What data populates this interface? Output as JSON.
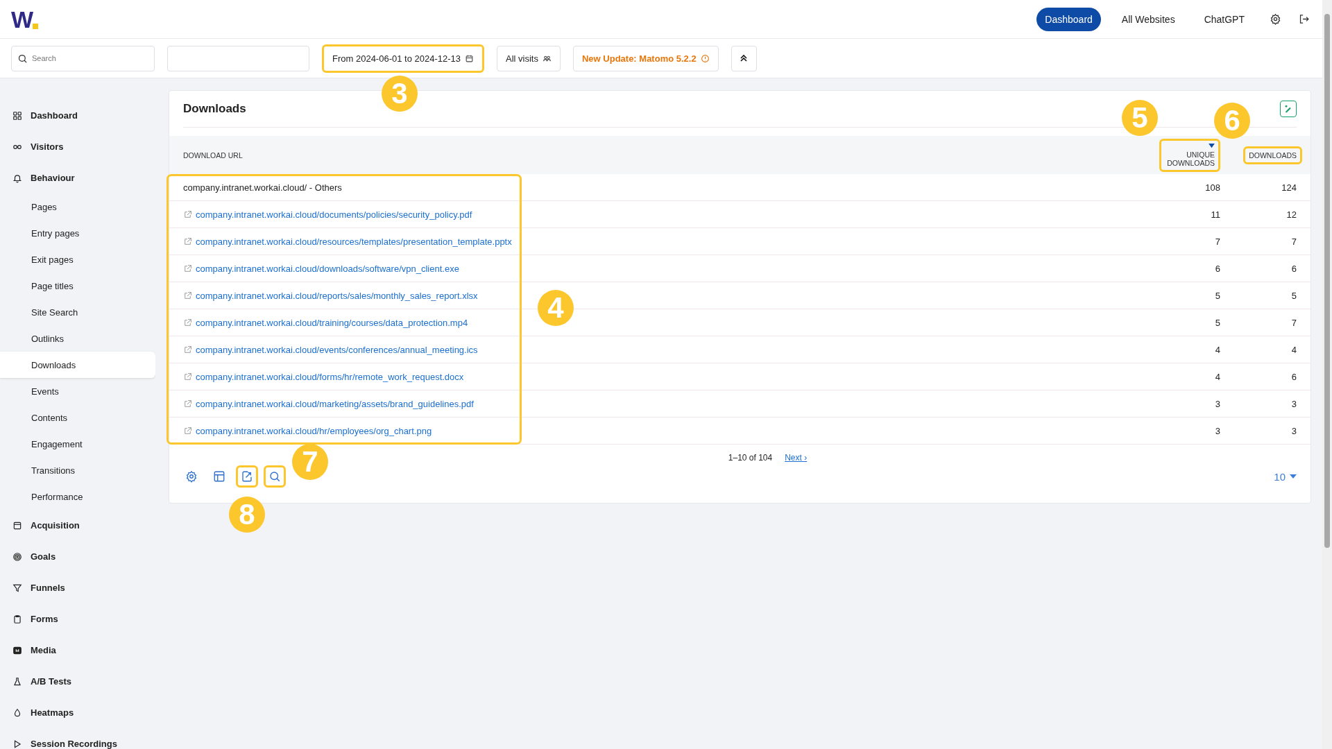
{
  "logo": "W",
  "top_nav": [
    {
      "label": "Dashboard",
      "selected": true
    },
    {
      "label": "All Websites",
      "selected": false
    },
    {
      "label": "ChatGPT",
      "selected": false
    }
  ],
  "toolbar": {
    "search": {
      "placeholder": "Search"
    },
    "date_range": {
      "label": "From 2024-06-01 to 2024-12-13",
      "highlighted": true,
      "callout": "3"
    },
    "segment": {
      "label": "All visits"
    },
    "update_notice": {
      "label": "New Update: Matomo 5.2.2"
    }
  },
  "sidebar": {
    "items": [
      {
        "label": "Dashboard",
        "selected": false
      },
      {
        "label": "Visitors",
        "selected": false
      },
      {
        "label": "Behaviour",
        "selected": false,
        "children": [
          {
            "label": "Pages",
            "selected": false
          },
          {
            "label": "Entry pages",
            "selected": false
          },
          {
            "label": "Exit pages",
            "selected": false
          },
          {
            "label": "Page titles",
            "selected": false
          },
          {
            "label": "Site Search",
            "selected": false
          },
          {
            "label": "Outlinks",
            "selected": false
          },
          {
            "label": "Downloads",
            "selected": true
          },
          {
            "label": "Events",
            "selected": false
          },
          {
            "label": "Contents",
            "selected": false
          },
          {
            "label": "Engagement",
            "selected": false
          },
          {
            "label": "Transitions",
            "selected": false
          },
          {
            "label": "Performance",
            "selected": false
          }
        ]
      },
      {
        "label": "Acquisition",
        "selected": false
      },
      {
        "label": "Goals",
        "selected": false
      },
      {
        "label": "Funnels",
        "selected": false
      },
      {
        "label": "Forms",
        "selected": false
      },
      {
        "label": "Media",
        "selected": false
      },
      {
        "label": "A/B Tests",
        "selected": false
      },
      {
        "label": "Heatmaps",
        "selected": false
      },
      {
        "label": "Session Recordings",
        "selected": false
      }
    ]
  },
  "report": {
    "title": "Downloads",
    "columns": [
      {
        "label": "DOWNLOAD URL",
        "sorted": false
      },
      {
        "label": "UNIQUE DOWNLOADS",
        "sorted": true,
        "highlighted": true,
        "callout": "5"
      },
      {
        "label": "DOWNLOADS",
        "sorted": false,
        "highlighted": true,
        "callout": "6"
      }
    ],
    "url_column": {
      "highlighted": true,
      "callout": "4"
    },
    "rows": [
      {
        "kind": "group",
        "url": "company.intranet.workai.cloud/ - Others",
        "unique_downloads": "108",
        "downloads": "124"
      },
      {
        "kind": "link",
        "url": "company.intranet.workai.cloud/documents/policies/security_policy.pdf",
        "unique_downloads": "11",
        "downloads": "12"
      },
      {
        "kind": "link",
        "url": "company.intranet.workai.cloud/resources/templates/presentation_template.pptx",
        "unique_downloads": "7",
        "downloads": "7"
      },
      {
        "kind": "link",
        "url": "company.intranet.workai.cloud/downloads/software/vpn_client.exe",
        "unique_downloads": "6",
        "downloads": "6"
      },
      {
        "kind": "link",
        "url": "company.intranet.workai.cloud/reports/sales/monthly_sales_report.xlsx",
        "unique_downloads": "5",
        "downloads": "5"
      },
      {
        "kind": "link",
        "url": "company.intranet.workai.cloud/training/courses/data_protection.mp4",
        "unique_downloads": "5",
        "downloads": "7"
      },
      {
        "kind": "link",
        "url": "company.intranet.workai.cloud/events/conferences/annual_meeting.ics",
        "unique_downloads": "4",
        "downloads": "4"
      },
      {
        "kind": "link",
        "url": "company.intranet.workai.cloud/forms/hr/remote_work_request.docx",
        "unique_downloads": "4",
        "downloads": "6"
      },
      {
        "kind": "link",
        "url": "company.intranet.workai.cloud/marketing/assets/brand_guidelines.pdf",
        "unique_downloads": "3",
        "downloads": "3"
      },
      {
        "kind": "link",
        "url": "company.intranet.workai.cloud/hr/employees/org_chart.png",
        "unique_downloads": "3",
        "downloads": "3"
      }
    ],
    "pagination": {
      "range": "1–10 of 104",
      "next": "Next ›"
    },
    "footer_tools": [
      {
        "kind": "settings",
        "highlighted": false
      },
      {
        "kind": "table",
        "highlighted": false
      },
      {
        "kind": "export",
        "highlighted": true,
        "callout": "8"
      },
      {
        "kind": "search",
        "highlighted": true,
        "callout": "7"
      }
    ],
    "page_size": "10"
  }
}
